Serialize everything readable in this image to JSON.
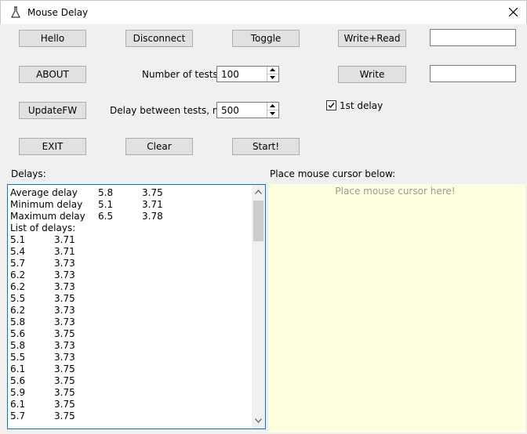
{
  "window": {
    "title": "Mouse Delay",
    "icon": "flask-icon",
    "close_icon": "close-icon"
  },
  "buttons": {
    "hello": "Hello",
    "disconnect": "Disconnect",
    "toggle": "Toggle",
    "write_read": "Write+Read",
    "about": "ABOUT",
    "write": "Write",
    "update_fw": "UpdateFW",
    "exit": "EXIT",
    "clear": "Clear",
    "start": "Start!"
  },
  "fields": {
    "write_read_text": "",
    "write_text": ""
  },
  "settings": {
    "num_tests_label": "Number of tests",
    "num_tests_value": "100",
    "delay_label": "Delay between tests, ms",
    "delay_value": "500",
    "first_delay_label": "1st delay",
    "first_delay_checked": true
  },
  "delays": {
    "label": "Delays:",
    "summary": [
      {
        "name": "Average delay",
        "v1": "5.8",
        "v2": "3.75"
      },
      {
        "name": "Minimum delay",
        "v1": "5.1",
        "v2": "3.71"
      },
      {
        "name": "Maximum delay",
        "v1": "6.5",
        "v2": "3.78"
      }
    ],
    "list_header": "List of delays:",
    "list": [
      {
        "a": "5.1",
        "b": "3.71"
      },
      {
        "a": "5.4",
        "b": "3.71"
      },
      {
        "a": "5.7",
        "b": "3.73"
      },
      {
        "a": "6.2",
        "b": "3.73"
      },
      {
        "a": "6.2",
        "b": "3.73"
      },
      {
        "a": "5.5",
        "b": "3.75"
      },
      {
        "a": "6.2",
        "b": "3.73"
      },
      {
        "a": "5.8",
        "b": "3.73"
      },
      {
        "a": "5.6",
        "b": "3.75"
      },
      {
        "a": "5.8",
        "b": "3.73"
      },
      {
        "a": "5.5",
        "b": "3.73"
      },
      {
        "a": "6.1",
        "b": "3.75"
      },
      {
        "a": "5.6",
        "b": "3.75"
      },
      {
        "a": "5.9",
        "b": "3.75"
      },
      {
        "a": "6.1",
        "b": "3.75"
      },
      {
        "a": "5.7",
        "b": "3.75"
      }
    ]
  },
  "cursor_area": {
    "label": "Place mouse cursor below:",
    "hint": "Place mouse cursor here!",
    "background": "#ffffe0"
  },
  "colors": {
    "focus_border": "#0078d7",
    "button_face": "#e1e1e1"
  }
}
